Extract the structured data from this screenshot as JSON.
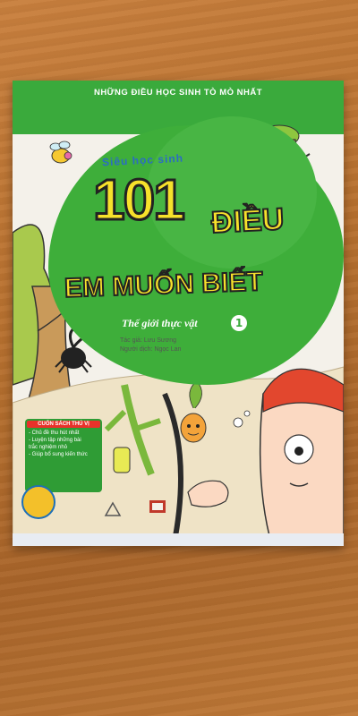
{
  "cover": {
    "series": "NHỮNG ĐIỀU HỌC SINH TÒ MÒ NHẤT",
    "kicker": "Siêu học sinh",
    "number": "101",
    "title_word": "ĐIỀU",
    "title_line": "EM MUỐN BIẾT",
    "volume_title": "Thế giới thực vật",
    "volume_number": "1",
    "author": "Tác giả: Lưu Sương",
    "translator": "Người dịch: Ngọc Lan",
    "info_box": {
      "heading": "CUỐN SÁCH THÚ VỊ",
      "items": [
        "- Chủ đề thu hút nhất",
        "- Luyện tập những bài",
        "  trắc nghiệm nhỏ",
        "- Giúp bổ sung kiến thức"
      ]
    }
  },
  "colors": {
    "green": "#3aaa3c",
    "yellow": "#f7e12b",
    "wood": "#b8712f",
    "blue": "#2b6cc4"
  },
  "icons": [
    "bee-illustration",
    "tree-character-illustration",
    "beetle-illustration",
    "boy-face-illustration",
    "publisher-logo",
    "bee-logo",
    "brand-logo"
  ]
}
